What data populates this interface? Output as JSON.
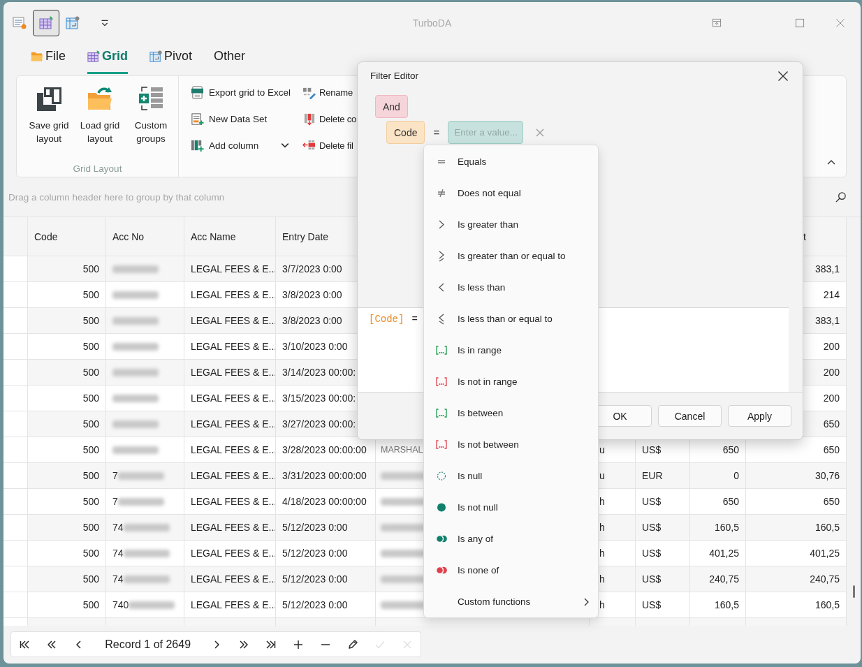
{
  "title_bar": {
    "title": "TurboDA",
    "quick_access": [
      {
        "kind": "list",
        "selected": false
      },
      {
        "kind": "grid",
        "selected": true
      },
      {
        "kind": "pivot",
        "selected": false
      }
    ]
  },
  "ribbon_tabs": [
    {
      "label": "File",
      "kind": "file",
      "selected": false
    },
    {
      "label": "Grid",
      "kind": "grid",
      "selected": true
    },
    {
      "label": "Pivot",
      "kind": "pivot",
      "selected": false
    },
    {
      "label": "Other",
      "kind": "plain",
      "selected": false
    }
  ],
  "ribbon": {
    "group": {
      "label": "Grid Layout",
      "buttons": [
        {
          "label": "Save grid layout",
          "kind": "save"
        },
        {
          "label": "Load grid layout",
          "kind": "load"
        },
        {
          "label": "Custom groups",
          "kind": "custom"
        }
      ]
    },
    "command_columns": [
      [
        {
          "label": "Export grid to Excel",
          "kind": "export",
          "dropdown": false
        },
        {
          "label": "New Data Set",
          "kind": "new",
          "dropdown": false
        },
        {
          "label": "Add column",
          "kind": "add_column",
          "dropdown": true
        }
      ],
      [
        {
          "label": "Rename",
          "kind": "rename",
          "dropdown": false
        },
        {
          "label": "Delete co",
          "kind": "delete_column",
          "dropdown": false
        },
        {
          "label": "Delete fil",
          "kind": "delete_filter",
          "dropdown": false
        }
      ]
    ]
  },
  "group_panel": {
    "placeholder": "Drag a column header here to group by that column"
  },
  "grid": {
    "columns": [
      "Code",
      "Acc No",
      "Acc Name",
      "Entry Date",
      "t"
    ],
    "rows": [
      {
        "code": "500",
        "acc_no_blurred": true,
        "acc_name": "LEGAL FEES & E...",
        "entry_date": "3/7/2023 0:00",
        "column_9": "383,1"
      },
      {
        "code": "500",
        "acc_no_blurred": true,
        "acc_name": "LEGAL FEES & E...",
        "entry_date": "3/8/2023 0:00",
        "column_9": "214"
      },
      {
        "code": "500",
        "acc_no_blurred": true,
        "acc_name": "LEGAL FEES & E...",
        "entry_date": "3/8/2023 0:00",
        "column_9": "383,1"
      },
      {
        "code": "500",
        "acc_no_blurred": true,
        "acc_name": "LEGAL FEES & E...",
        "entry_date": "3/10/2023 0:00",
        "column_9": "200"
      },
      {
        "code": "500",
        "acc_no_blurred": true,
        "acc_name": "LEGAL FEES & E...",
        "entry_date": "3/14/2023 00:00:",
        "column_9": "200"
      },
      {
        "code": "500",
        "acc_no_blurred": true,
        "acc_name": "LEGAL FEES & E...",
        "entry_date": "3/15/2023 00:00:",
        "column_9": "200"
      },
      {
        "code": "500",
        "acc_no_blurred": true,
        "acc_name": "LEGAL FEES & E...",
        "entry_date": "3/27/2023 00:00:",
        "column_9": "650"
      },
      {
        "code": "500",
        "acc_no_blurred": true,
        "acc_name": "LEGAL FEES & E...",
        "entry_date": "3/28/2023 00:00:00",
        "column_5": "MARSHAL",
        "column_6": "u",
        "column_7": "US$",
        "column_8": "650",
        "column_9": "650"
      },
      {
        "code": "500",
        "acc_no_prefix": "7",
        "acc_no_blurred": true,
        "acc_name": "LEGAL FEES & E...",
        "entry_date": "3/31/2023 00:00:00",
        "column_5_blurred": true,
        "column_6": "u",
        "column_7": "EUR",
        "column_8": "0",
        "column_9": "30,76"
      },
      {
        "code": "500",
        "acc_no_prefix": "7",
        "acc_no_blurred": true,
        "acc_name": "LEGAL FEES & E...",
        "entry_date": "4/18/2023 00:00:00",
        "column_5_blurred": true,
        "column_6": "h",
        "column_7": "US$",
        "column_8": "650",
        "column_9": "650"
      },
      {
        "code": "500",
        "acc_no_prefix": "74",
        "acc_no_blurred": true,
        "acc_name": "LEGAL FEES & E...",
        "entry_date": "5/12/2023 0:00",
        "column_5_blurred": true,
        "column_6": "h",
        "column_7": "US$",
        "column_8": "160,5",
        "column_9": "160,5"
      },
      {
        "code": "500",
        "acc_no_prefix": "74",
        "acc_no_blurred": true,
        "acc_name": "LEGAL FEES & E...",
        "entry_date": "5/12/2023 0:00",
        "column_5_blurred": true,
        "column_6": "h",
        "column_7": "US$",
        "column_8": "401,25",
        "column_9": "401,25"
      },
      {
        "code": "500",
        "acc_no_prefix": "74",
        "acc_no_blurred": true,
        "acc_name": "LEGAL FEES & E...",
        "entry_date": "5/12/2023 0:00",
        "column_5_blurred": true,
        "column_6": "h",
        "column_7": "US$",
        "column_8": "240,75",
        "column_9": "240,75"
      },
      {
        "code": "500",
        "acc_no_prefix": "740",
        "acc_no_blurred": true,
        "acc_name": "LEGAL FEES & E...",
        "entry_date": "5/12/2023 0:00",
        "column_5_blurred": true,
        "column_6": "h",
        "column_7": "US$",
        "column_8": "160,5",
        "column_9": "160,5"
      }
    ]
  },
  "pager": {
    "record_text": "Record 1 of 2649",
    "buttons": [
      {
        "kind": "first",
        "disabled": false
      },
      {
        "kind": "prev_page",
        "disabled": false
      },
      {
        "kind": "prev",
        "disabled": false
      },
      {
        "kind": "next",
        "disabled": false
      },
      {
        "kind": "next_page",
        "disabled": false
      },
      {
        "kind": "last",
        "disabled": false
      },
      {
        "kind": "add",
        "disabled": false
      },
      {
        "kind": "remove",
        "disabled": false
      },
      {
        "kind": "edit",
        "disabled": false
      },
      {
        "kind": "accept",
        "disabled": true
      },
      {
        "kind": "cancel",
        "disabled": true
      }
    ]
  },
  "filter_editor": {
    "title": "Filter Editor",
    "group_operator": "And",
    "condition": {
      "field": "Code",
      "operator": "=",
      "value_placeholder": "Enter a value..."
    },
    "expression": {
      "field": "[Code]",
      "operator": "="
    },
    "buttons": [
      "OK",
      "Cancel",
      "Apply"
    ],
    "operator_menu": [
      {
        "label": "Equals",
        "kind": "equals"
      },
      {
        "label": "Does not equal",
        "kind": "not_equals"
      },
      {
        "label": "Is greater than",
        "kind": "greater"
      },
      {
        "label": "Is greater than or equal to",
        "kind": "greater_or_equal"
      },
      {
        "label": "Is less than",
        "kind": "less"
      },
      {
        "label": "Is less than or equal to",
        "kind": "less_or_equal"
      },
      {
        "label": "Is in range",
        "kind": "in_range"
      },
      {
        "label": "Is not in range",
        "kind": "not_in_range"
      },
      {
        "label": "Is between",
        "kind": "between"
      },
      {
        "label": "Is not between",
        "kind": "not_between"
      },
      {
        "label": "Is null",
        "kind": "null"
      },
      {
        "label": "Is not null",
        "kind": "not_null"
      },
      {
        "label": "Is any of",
        "kind": "any_of"
      },
      {
        "label": "Is none of",
        "kind": "none_of"
      },
      {
        "label": "Custom functions",
        "kind": "submenu"
      }
    ]
  }
}
